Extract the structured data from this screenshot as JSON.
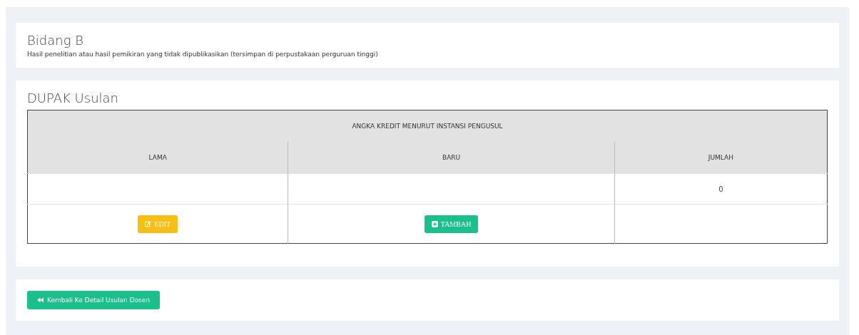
{
  "section": {
    "title": "Bidang B",
    "description": "Hasil penelitian atau hasil pemikiran yang tidak dipublikasikan (tersimpan di perpustakaan perguruan tinggi)"
  },
  "dupak": {
    "title": "DUPAK Usulan",
    "group_header": "ANGKA KREDIT MENURUT INSTANSI PENGUSUL",
    "columns": [
      "LAMA",
      "BARU",
      "JUMLAH"
    ],
    "total": "0",
    "actions": [
      {
        "kind": "edit",
        "label": "EDIT"
      },
      {
        "kind": "add",
        "label": "TAMBAH"
      },
      {
        "kind": "none"
      }
    ]
  },
  "back_button": {
    "label": "Kembali Ke Detail Usulan Dosen"
  }
}
